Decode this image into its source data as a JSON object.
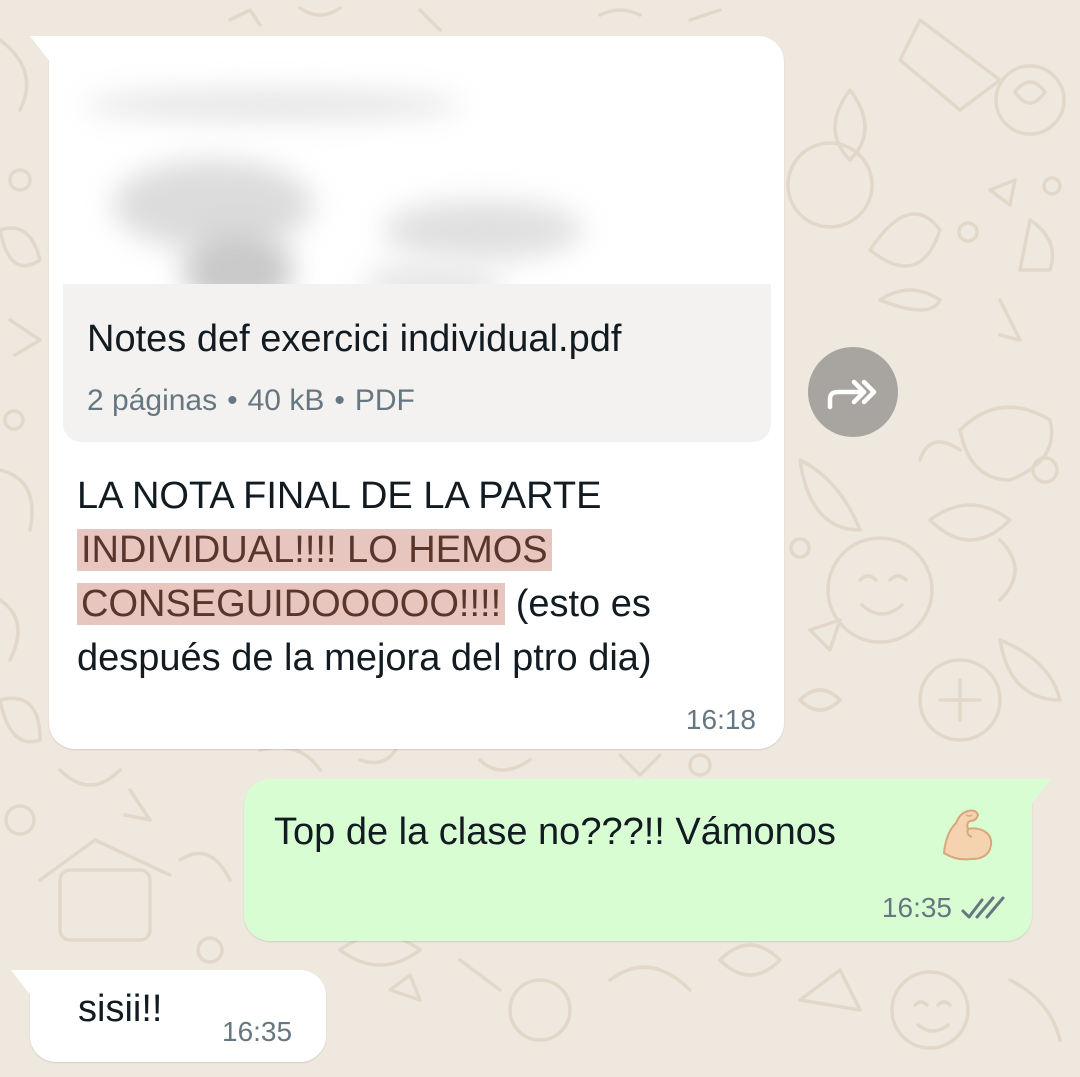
{
  "theme": {
    "wallpaper": "#efe8de",
    "incoming_bubble": "#ffffff",
    "outgoing_bubble": "#d9fdd3",
    "highlight": "#e6c6be",
    "read_ticks": "#667781"
  },
  "messages": [
    {
      "direction": "incoming",
      "document": {
        "file_name": "Notes def exercici individual.pdf",
        "pages": "2 páginas",
        "size": "40 kB",
        "type": "PDF",
        "separator": "•"
      },
      "text_part1": "LA NOTA FINAL DE LA PARTE",
      "text_highlight_line1": "INDIVIDUAL!!!! LO HEMOS",
      "text_highlight_line2": "CONSEGUIDOOOOO!!!!",
      "text_part2": " (esto es después de la mejora del ptro dia)",
      "time": "16:18"
    },
    {
      "direction": "outgoing",
      "text": "Top de la clase no???!! Vámonos",
      "emoji": "flexed-biceps",
      "time": "16:35",
      "status": "read"
    },
    {
      "direction": "incoming",
      "text": "sisii!!",
      "time": "16:35"
    }
  ],
  "forward_button": {
    "icon": "forward-icon"
  }
}
